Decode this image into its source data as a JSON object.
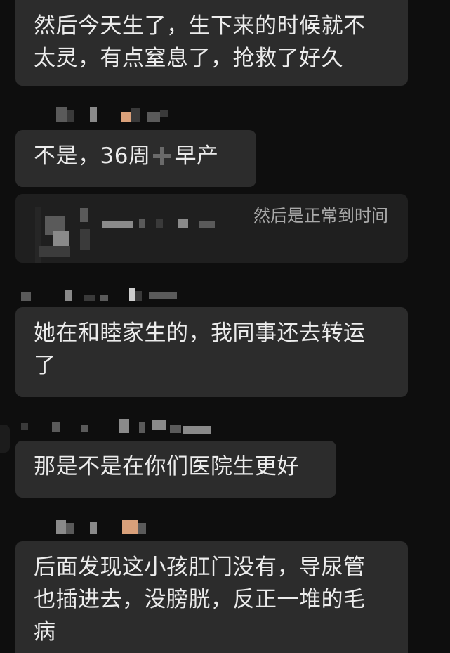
{
  "messages": {
    "m1_line1": "然后今天生了，生下来的时候就不",
    "m1_line2": "太灵，有点窒息了，抢救了好久",
    "m2_part1": "不是，36周",
    "m2_part2": "早产",
    "m3_quote": "然后是正常到时间",
    "m4_line1": "她在和睦家生的，我同事还去转运",
    "m4_line2": "了",
    "m5_line1": "那是不是在你们医院生更好",
    "m6_line1": "后面发现这小孩肛门没有，导尿管",
    "m6_line2": "也插进去，没膀胱，反正一堆的毛",
    "m6_line3": "病"
  },
  "icons": {
    "back": "chevron-left-icon",
    "plus": "plus-icon"
  },
  "colors": {
    "background": "#0e0e0e",
    "bubble": "#2c2c2c",
    "quote_bubble": "#1f1f1f",
    "text": "#ececec",
    "quote_text": "#a9a9a9"
  }
}
